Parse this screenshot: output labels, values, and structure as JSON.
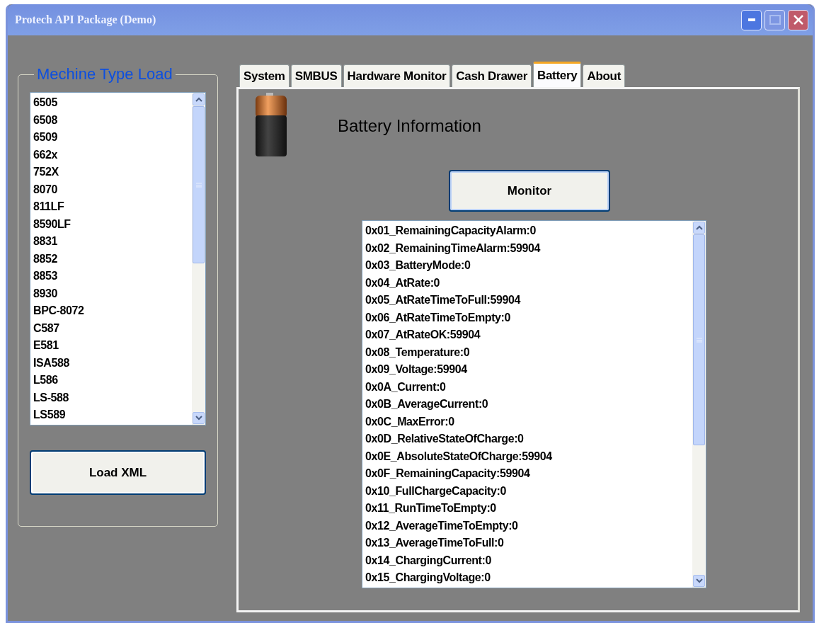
{
  "window": {
    "title": "Protech API Package (Demo)"
  },
  "machine_group": {
    "title": "Mechine Type Load",
    "items": [
      "6505",
      "6508",
      "6509",
      "662x",
      "752X",
      "8070",
      "811LF",
      "8590LF",
      "8831",
      "8852",
      "8853",
      "8930",
      "BPC-8072",
      "C587",
      "E581",
      "ISA588",
      "L586",
      "LS-588",
      "LS589"
    ],
    "button": "Load XML"
  },
  "tabs": [
    {
      "label": "System",
      "selected": false
    },
    {
      "label": "SMBUS",
      "selected": false
    },
    {
      "label": "Hardware Monitor",
      "selected": false
    },
    {
      "label": "Cash Drawer",
      "selected": false
    },
    {
      "label": "Battery",
      "selected": true
    },
    {
      "label": "About",
      "selected": false
    }
  ],
  "battery_panel": {
    "title": "Battery Information",
    "button": "Monitor",
    "readings": [
      "0x01_RemainingCapacityAlarm:0",
      "0x02_RemainingTimeAlarm:59904",
      "0x03_BatteryMode:0",
      "0x04_AtRate:0",
      "0x05_AtRateTimeToFull:59904",
      "0x06_AtRateTimeToEmpty:0",
      "0x07_AtRateOK:59904",
      "0x08_Temperature:0",
      "0x09_Voltage:59904",
      "0x0A_Current:0",
      "0x0B_AverageCurrent:0",
      "0x0C_MaxError:0",
      "0x0D_RelativeStateOfCharge:0",
      "0x0E_AbsoluteStateOfCharge:59904",
      "0x0F_RemainingCapacity:59904",
      "0x10_FullChargeCapacity:0",
      "0x11_RunTimeToEmpty:0",
      "0x12_AverageTimeToEmpty:0",
      "0x13_AverageTimeToFull:0",
      "0x14_ChargingCurrent:0",
      "0x15_ChargingVoltage:0"
    ]
  }
}
